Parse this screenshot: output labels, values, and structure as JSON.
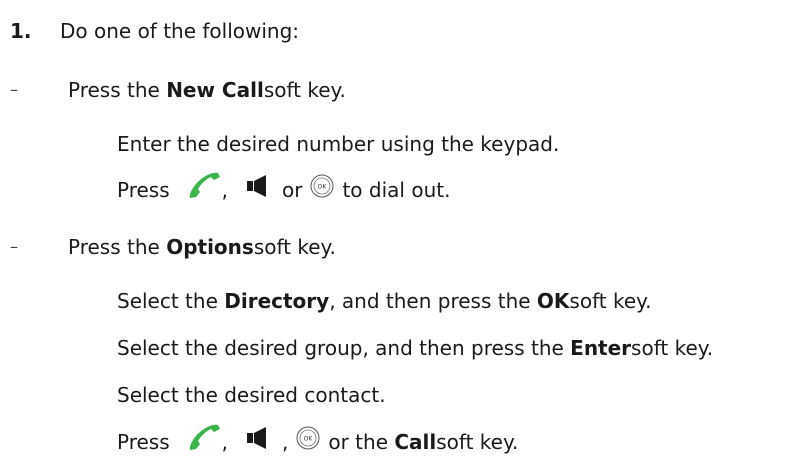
{
  "step": {
    "number": "1.",
    "text": "Do one of the following:"
  },
  "dash": "–",
  "option1": {
    "prefix": "Press the ",
    "key": "New Call",
    "suffix": " soft key.",
    "sub1": "Enter the desired number using the keypad.",
    "sub2": {
      "press": "Press",
      "comma": ",",
      "or": "or",
      "end": "to dial out."
    }
  },
  "option2": {
    "prefix": "Press the ",
    "key": "Options",
    "suffix": " soft key.",
    "sub1": {
      "a": "Select the ",
      "b": "Directory",
      "c": ", and then press the ",
      "d": "OK",
      "e": " soft key."
    },
    "sub2": {
      "a": "Select the desired group, and then press the ",
      "b": "Enter",
      "c": " soft key."
    },
    "sub3": "Select the desired contact.",
    "sub4": {
      "press": "Press",
      "comma1": ",",
      "comma2": ",",
      "or": "or the ",
      "key": "Call",
      "end": " soft key."
    }
  },
  "icons": {
    "handset": "handset-icon",
    "speaker": "speakerphone-icon",
    "ok": "ok-key-icon",
    "handset_color": "#3ab54a"
  }
}
